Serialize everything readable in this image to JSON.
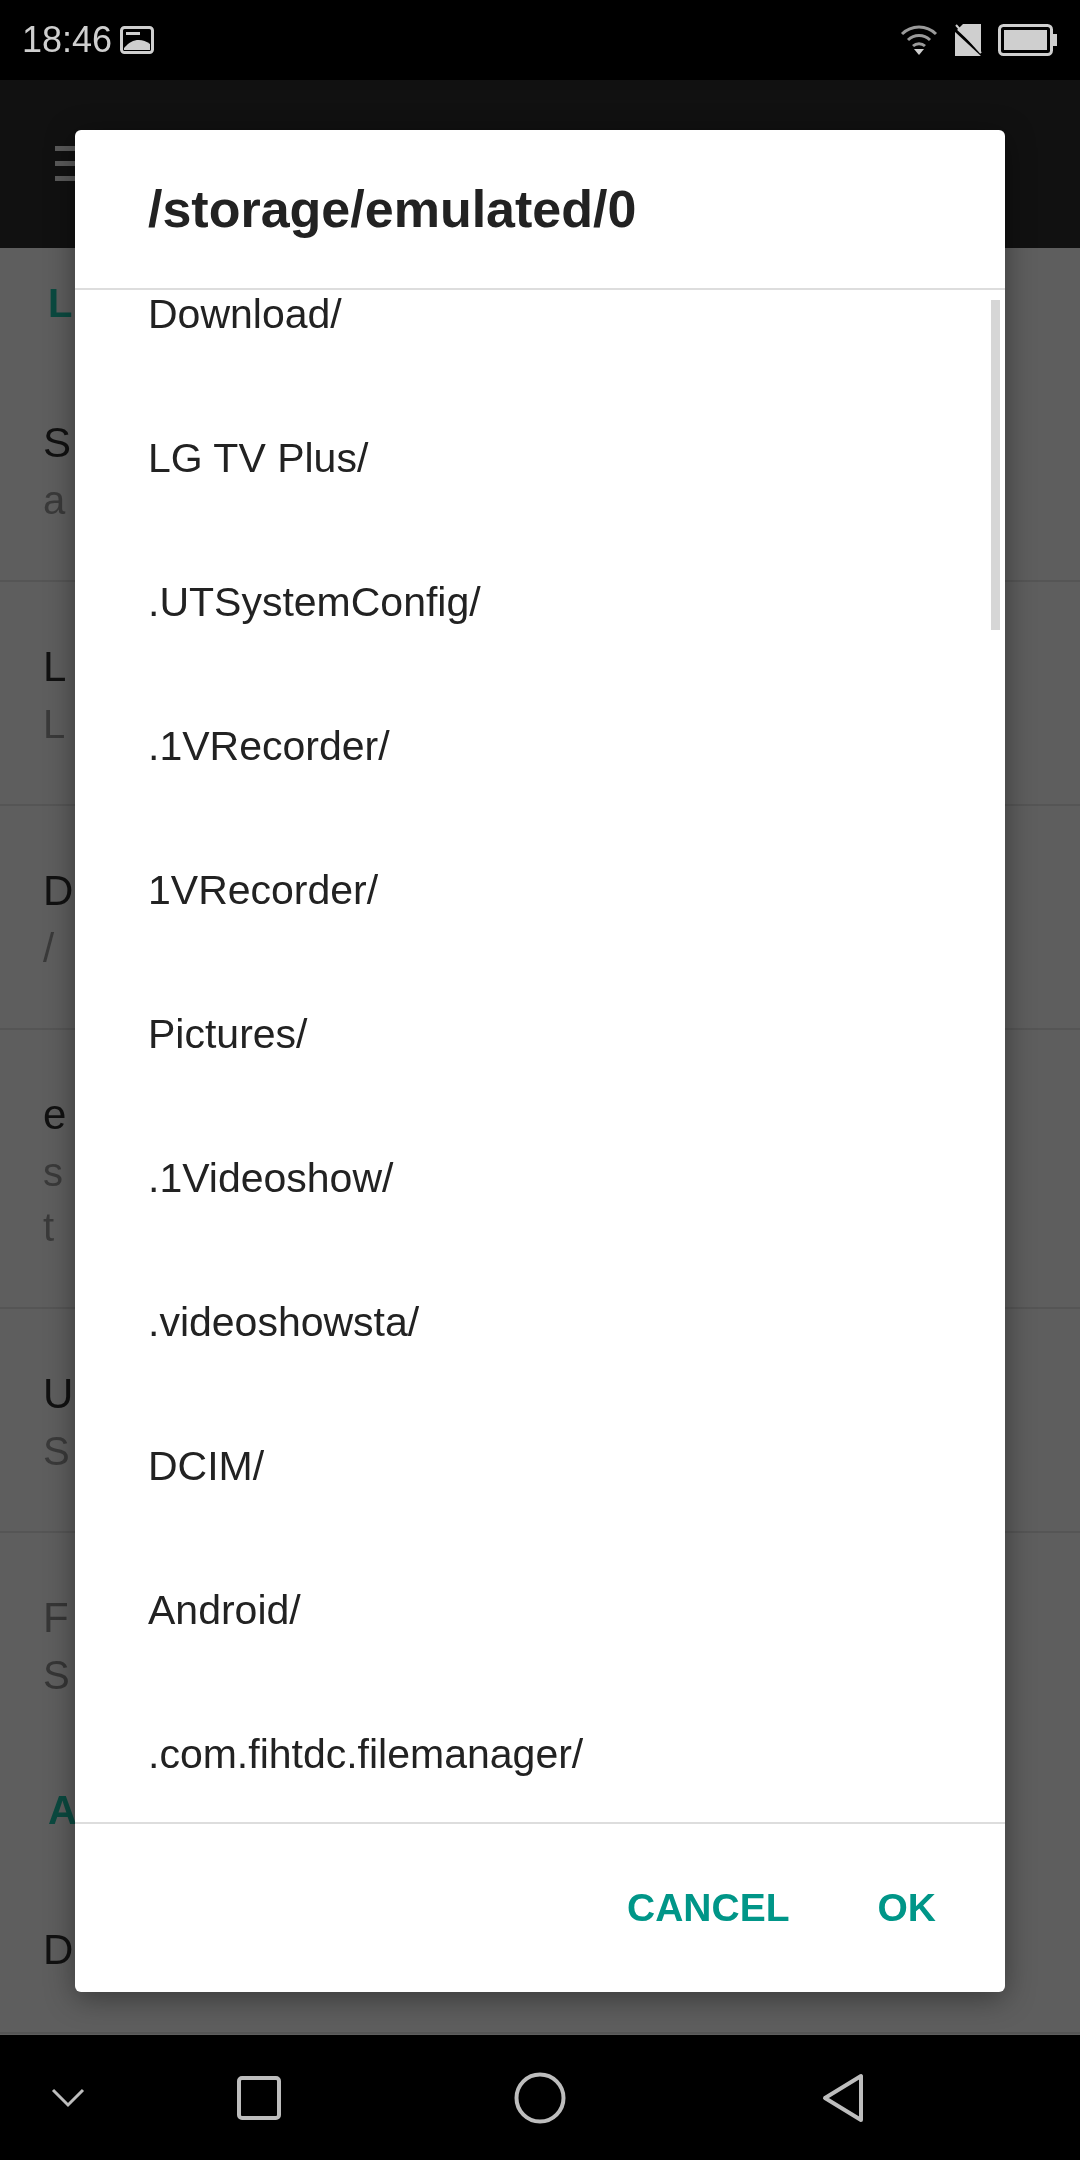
{
  "status_bar": {
    "time": "18:46"
  },
  "background_settings": [
    {
      "kind": "header",
      "text": "L"
    },
    {
      "kind": "item",
      "title": "S",
      "subtitle": [
        "a"
      ],
      "disabled": false
    },
    {
      "kind": "item",
      "title": "L",
      "subtitle": [
        "L"
      ],
      "disabled": false
    },
    {
      "kind": "item",
      "title": "D",
      "subtitle": [
        "/"
      ],
      "disabled": false
    },
    {
      "kind": "item",
      "title": "e",
      "subtitle": [
        "s",
        "t"
      ],
      "disabled": false
    },
    {
      "kind": "item",
      "title": "U",
      "subtitle": [
        "S"
      ],
      "disabled": false
    },
    {
      "kind": "item",
      "title": "F",
      "subtitle": [
        "S"
      ],
      "disabled": true
    },
    {
      "kind": "header",
      "text": "A"
    },
    {
      "kind": "item",
      "title": "D",
      "disabled": false
    }
  ],
  "dialog": {
    "title": "/storage/emulated/0",
    "folders": [
      "Download/",
      "LG TV Plus/",
      ".UTSystemConfig/",
      ".1VRecorder/",
      "1VRecorder/",
      "Pictures/",
      ".1Videoshow/",
      ".videoshowsta/",
      "DCIM/",
      "Android/",
      ".com.fihtdc.filemanager/"
    ],
    "buttons": [
      {
        "label": "CANCEL"
      },
      {
        "label": "OK"
      }
    ]
  }
}
